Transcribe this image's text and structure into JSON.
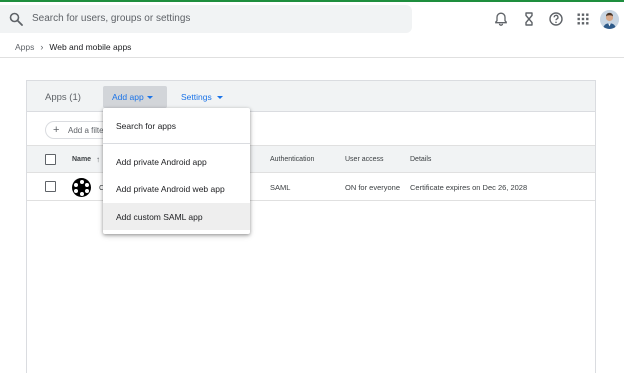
{
  "topbar": {
    "search_placeholder": "Search for users, groups or settings",
    "icons": [
      "notifications-icon",
      "hourglass-icon",
      "help-icon",
      "apps-grid-icon",
      "avatar"
    ]
  },
  "breadcrumb": {
    "root": "Apps",
    "separator": "›",
    "current": "Web and mobile apps"
  },
  "panel": {
    "title": "Apps (1)",
    "add_app_label": "Add app",
    "settings_label": "Settings",
    "filter_label": "Add a filter"
  },
  "table": {
    "columns": {
      "name": "Name",
      "authentication": "Authentication",
      "user_access": "User access",
      "details": "Details"
    },
    "sort_indicator": "↑",
    "rows": [
      {
        "name_visible": "C",
        "authentication": "SAML",
        "user_access": "ON for everyone",
        "details": "Certificate expires on Dec 26, 2028"
      }
    ]
  },
  "menu": {
    "items": [
      "Search for apps",
      "Add private Android app",
      "Add private Android web app",
      "Add custom SAML app"
    ],
    "highlighted": "Add custom SAML app"
  },
  "colors": {
    "accent": "#1a73e8",
    "top_line": "#1e8e3e",
    "header_bg": "#f1f3f4"
  }
}
